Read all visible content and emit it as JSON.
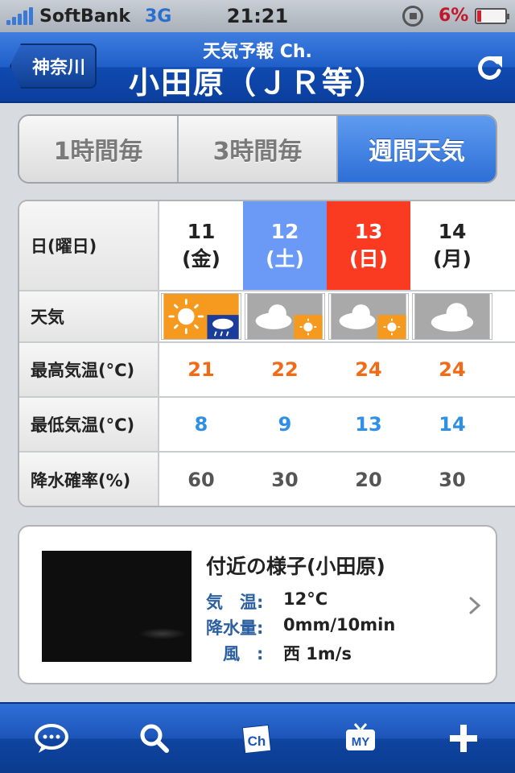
{
  "status": {
    "carrier": "SoftBank",
    "network": "3G",
    "time": "21:21",
    "battery": "6%",
    "battery_level": 0.06
  },
  "nav": {
    "back_label": "神奈川",
    "subtitle": "天気予報 Ch.",
    "title": "小田原（ＪＲ等）"
  },
  "tabs": [
    {
      "label": "1時間毎",
      "active": false
    },
    {
      "label": "3時間毎",
      "active": false
    },
    {
      "label": "週間天気",
      "active": true
    }
  ],
  "forecast": {
    "headers": {
      "day": "日(曜日)",
      "weather": "天気",
      "high": "最高気温(°C)",
      "low": "最低気温(°C)",
      "precip": "降水確率(%)"
    },
    "days": [
      {
        "date": "11",
        "weekday": "(金)",
        "type": "weekday",
        "weather_icon": "sun-then-rain-icon",
        "high": "21",
        "low": "8",
        "precip": "60"
      },
      {
        "date": "12",
        "weekday": "(土)",
        "type": "sat",
        "weather_icon": "cloud-then-sun-icon",
        "high": "22",
        "low": "9",
        "precip": "30"
      },
      {
        "date": "13",
        "weekday": "(日)",
        "type": "sun",
        "weather_icon": "cloud-then-sun-icon",
        "high": "24",
        "low": "13",
        "precip": "20"
      },
      {
        "date": "14",
        "weekday": "(月)",
        "type": "weekday",
        "weather_icon": "cloud-icon",
        "high": "24",
        "low": "14",
        "precip": "30"
      }
    ],
    "colors": {
      "saturday": "#6a9af5",
      "sunday": "#fa3b22",
      "high": "#f26a14",
      "low": "#2e8fe6"
    }
  },
  "nearby": {
    "title": "付近の様子(小田原)",
    "rows": [
      {
        "label": "気　温:",
        "value": "12°C"
      },
      {
        "label": "降水量:",
        "value": "0mm/10min"
      },
      {
        "label": "　風　:",
        "value": "西 1m/s"
      }
    ]
  },
  "tabbar": [
    {
      "icon": "chat-bubble-icon"
    },
    {
      "icon": "search-icon"
    },
    {
      "icon": "channel-ch-icon",
      "text": "Ch"
    },
    {
      "icon": "my-tv-icon",
      "text": "MY"
    },
    {
      "icon": "plus-icon"
    }
  ]
}
